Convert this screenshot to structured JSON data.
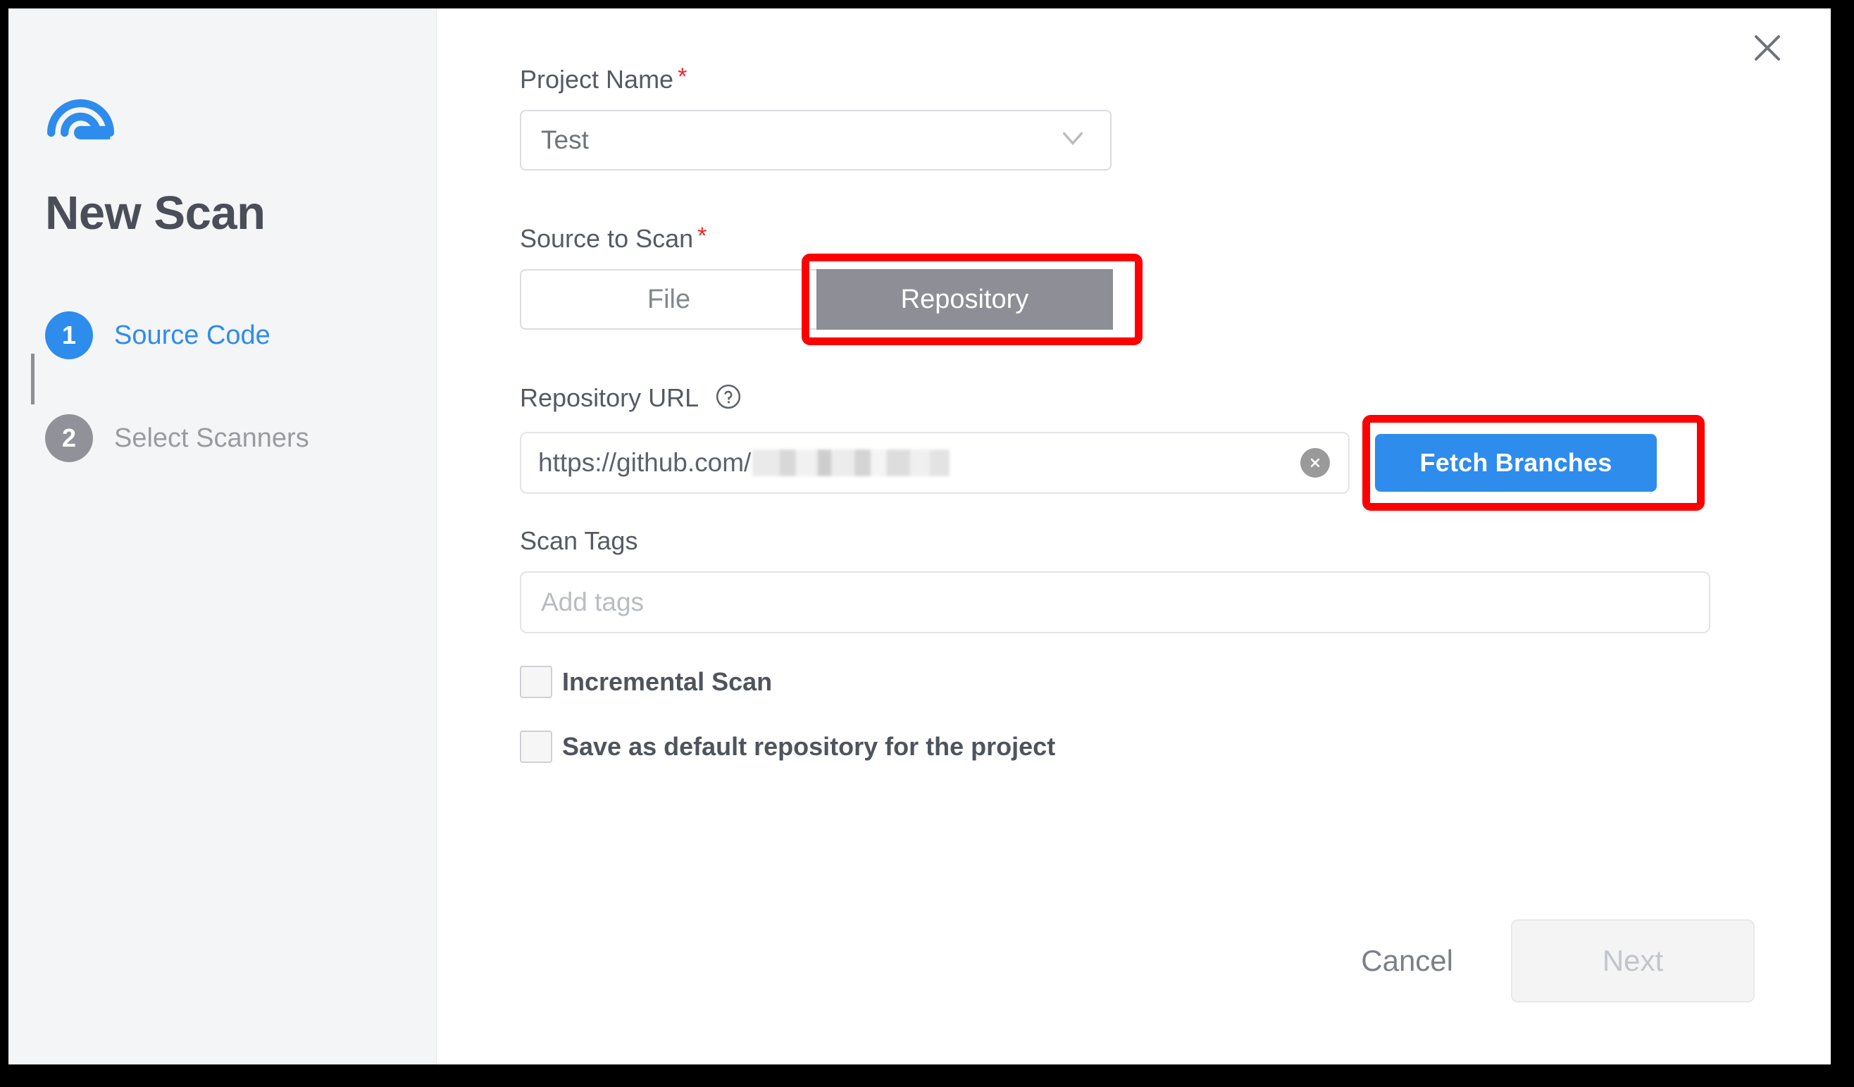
{
  "window": {
    "close_icon": "close-icon"
  },
  "sidebar": {
    "logo_icon": "radar-spiral-logo",
    "title": "New Scan",
    "steps": [
      {
        "number": "1",
        "label": "Source Code",
        "state": "active"
      },
      {
        "number": "2",
        "label": "Select Scanners",
        "state": "inactive"
      }
    ]
  },
  "form": {
    "project_name": {
      "label": "Project Name",
      "required_marker": "*",
      "value": "Test",
      "chevron_icon": "chevron-down-icon"
    },
    "source_to_scan": {
      "label": "Source to Scan",
      "required_marker": "*",
      "options": [
        "File",
        "Repository"
      ],
      "selected": "Repository"
    },
    "repository_url": {
      "label": "Repository URL",
      "help_icon": "help-circle-icon",
      "value_prefix": "https://github.com/",
      "value_redacted": true,
      "clear_icon": "clear-circle-icon"
    },
    "fetch_branches": {
      "label": "Fetch Branches"
    },
    "scan_tags": {
      "label": "Scan Tags",
      "placeholder": "Add tags",
      "value": ""
    },
    "checkboxes": [
      {
        "label": "Incremental Scan",
        "checked": false
      },
      {
        "label": "Save as default repository for the project",
        "checked": false
      }
    ]
  },
  "footer": {
    "cancel_label": "Cancel",
    "next_label": "Next",
    "next_disabled": true
  },
  "colors": {
    "accent_blue": "#2e8ced",
    "annotation_red": "#fe0000",
    "selected_toggle_gray": "#8d8e96",
    "sidebar_bg": "#f4f5f6",
    "required_red": "#f72121"
  }
}
